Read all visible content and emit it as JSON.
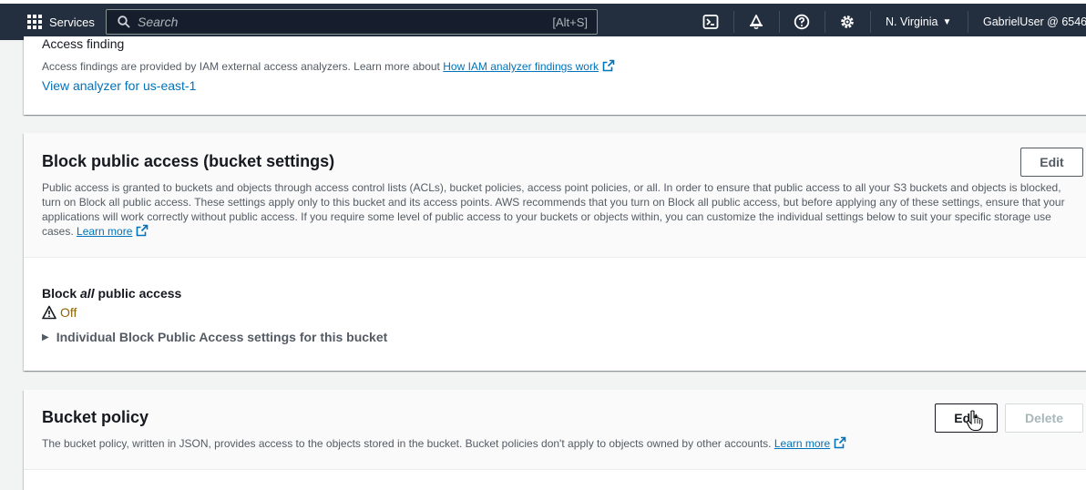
{
  "topnav": {
    "services_label": "Services",
    "search_placeholder": "Search",
    "search_shortcut": "[Alt+S]",
    "region": "N. Virginia",
    "user": "GabrielUser @ 6546-"
  },
  "access_finding": {
    "title": "Access finding",
    "desc": "Access findings are provided by IAM external access analyzers. Learn more about",
    "desc_link": "How IAM analyzer findings work",
    "analyzer_link": "View analyzer for us-east-1"
  },
  "block_public": {
    "title": "Block public access (bucket settings)",
    "edit_label": "Edit",
    "desc": "Public access is granted to buckets and objects through access control lists (ACLs), bucket policies, access point policies, or all. In order to ensure that public access to all your S3 buckets and objects is blocked, turn on Block all public access. These settings apply only to this bucket and its access points. AWS recommends that you turn on Block all public access, but before applying any of these settings, ensure that your applications will work correctly without public access. If you require some level of public access to your buckets or objects within, you can customize the individual settings below to suit your specific storage use cases.",
    "learn_more": "Learn more",
    "block_all_prefix": "Block ",
    "block_all_em": "all",
    "block_all_suffix": " public access",
    "status": "Off",
    "status_color": "#8d6605",
    "individual_settings": "Individual Block Public Access settings for this bucket"
  },
  "bucket_policy": {
    "title": "Bucket policy",
    "edit_label": "Edit",
    "delete_label": "Delete",
    "desc": "The bucket policy, written in JSON, provides access to the objects stored in the bucket. Bucket policies don't apply to objects owned by other accounts.",
    "learn_more": "Learn more"
  }
}
